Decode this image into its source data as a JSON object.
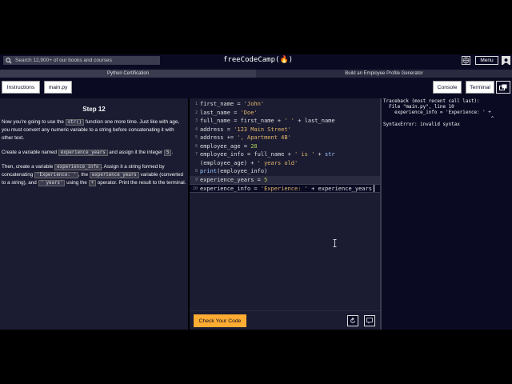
{
  "navbar": {
    "search_placeholder": "Search 12,900+ of our books and courses",
    "logo_text": "freeCodeCamp(🔥)",
    "menu_label": "Menu"
  },
  "breadcrumbs": [
    "Python Certification",
    "Build an Employee Profile Generator"
  ],
  "tabs": {
    "instructions": "Instructions",
    "main_py": "main.py",
    "console": "Console",
    "terminal": "Terminal"
  },
  "instructions": {
    "step_title": "Step 12",
    "p1_a": "Now you're going to use the ",
    "p1_code": "str()",
    "p1_b": " function one more time. Just like with age, you must convert any numeric variable to a string before concatenating it with other text.",
    "p2_a": "Create a variable named ",
    "p2_code1": "experience_years",
    "p2_b": " and assign it the integer ",
    "p2_code2": "5",
    "p2_c": ".",
    "p3_a": "Then, create a variable ",
    "p3_code1": "experience_info",
    "p3_b": ". Assign it a string formed by concatenating ",
    "p3_code2": "'Experience: '",
    "p3_c": ", the ",
    "p3_code3": "experience_years",
    "p3_d": " variable (converted to a string), and ",
    "p3_code4": "' years'",
    "p3_e": " using the ",
    "p3_code5": "+",
    "p3_f": " operator. Print the result to the terminal."
  },
  "editor": {
    "lines": [
      {
        "num": "1",
        "parts": [
          [
            "t",
            "first_name = "
          ],
          [
            "s",
            "'John'"
          ]
        ]
      },
      {
        "num": "2",
        "parts": [
          [
            "t",
            "last_name = "
          ],
          [
            "s",
            "'Doe'"
          ]
        ]
      },
      {
        "num": "3",
        "parts": [
          [
            "t",
            "full_name = first_name + "
          ],
          [
            "s",
            "' '"
          ],
          [
            "t",
            " + last_name"
          ]
        ]
      },
      {
        "num": "4",
        "parts": [
          [
            "t",
            "address = "
          ],
          [
            "s",
            "'123 Main Street'"
          ]
        ]
      },
      {
        "num": "5",
        "parts": [
          [
            "t",
            "address += "
          ],
          [
            "s",
            "', Apartment 4B'"
          ]
        ]
      },
      {
        "num": "6",
        "parts": [
          [
            "t",
            "employee_age = "
          ],
          [
            "k",
            "28"
          ]
        ]
      },
      {
        "num": "7",
        "parts": [
          [
            "t",
            "employee_info = full_name + "
          ],
          [
            "s",
            "' is '"
          ],
          [
            "t",
            " + "
          ],
          [
            "f",
            "str"
          ]
        ]
      },
      {
        "num": "",
        "parts": [
          [
            "t",
            "(employee_age) + "
          ],
          [
            "s",
            "' years old'"
          ]
        ]
      },
      {
        "num": "8",
        "parts": [
          [
            "f",
            "print"
          ],
          [
            "t",
            "(employee_info)"
          ]
        ]
      },
      {
        "num": "9",
        "parts": [
          [
            "t",
            "experience_years = "
          ],
          [
            "k",
            "5"
          ]
        ]
      },
      {
        "num": "10",
        "parts": [
          [
            "t",
            "experience_info = "
          ],
          [
            "s",
            "'Experience: '"
          ],
          [
            "t",
            " + experience_years"
          ]
        ]
      }
    ],
    "check_button": "Check Your Code"
  },
  "console": {
    "text": "Traceback (most recent call last):\n  File \"main.py\", line 10\n    experience_info = 'Experience: ' +\n                                      ^\nSyntaxError: invalid syntax"
  },
  "colors": {
    "accent_button": "#feac32",
    "background": "#0a0a23",
    "panel": "#1b1b32",
    "string": "#e2b86b",
    "number": "#acd157",
    "function": "#99c9ff"
  }
}
